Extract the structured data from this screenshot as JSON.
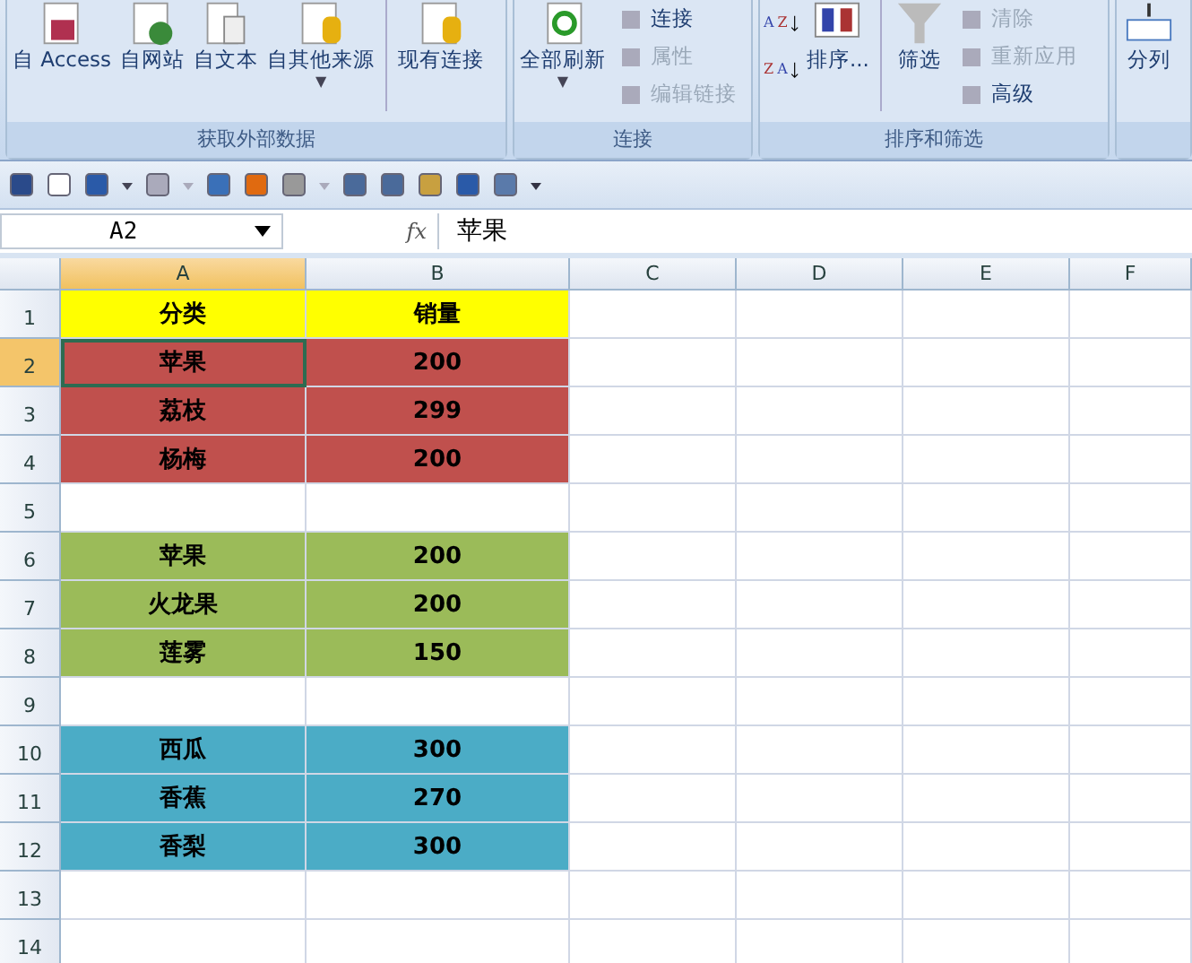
{
  "ribbon": {
    "groups": [
      {
        "label": "获取外部数据",
        "items": [
          {
            "kind": "large",
            "label": "自 Access"
          },
          {
            "kind": "large",
            "label": "自网站"
          },
          {
            "kind": "large",
            "label": "自文本"
          },
          {
            "kind": "large",
            "label": "自其他来源",
            "caret": "▼"
          },
          {
            "kind": "separator"
          },
          {
            "kind": "large",
            "label": "现有连接"
          }
        ]
      },
      {
        "label": "连接",
        "items": [
          {
            "kind": "large",
            "label": "全部刷新",
            "caret": "▼"
          },
          {
            "kind": "stack",
            "entries": [
              {
                "label": "连接",
                "disabled": false
              },
              {
                "label": "属性",
                "disabled": true
              },
              {
                "label": "编辑链接",
                "disabled": true
              }
            ]
          }
        ]
      },
      {
        "label": "排序和筛选",
        "items": [
          {
            "kind": "sortpair",
            "buttons": [
              {
                "top": "A",
                "bottom": "Z"
              },
              {
                "top": "Z",
                "bottom": "A"
              }
            ]
          },
          {
            "kind": "large",
            "label": "排序..."
          },
          {
            "kind": "separator"
          },
          {
            "kind": "large",
            "label": "筛选"
          },
          {
            "kind": "stack",
            "entries": [
              {
                "label": "清除",
                "disabled": true
              },
              {
                "label": "重新应用",
                "disabled": true
              },
              {
                "label": "高级",
                "disabled": false
              }
            ]
          }
        ]
      },
      {
        "items": [
          {
            "kind": "large",
            "label": "分列"
          }
        ]
      }
    ]
  },
  "formula_bar": {
    "name_box": "A2",
    "function_label": "fx",
    "formula": "苹果"
  },
  "sheet": {
    "columns": [
      {
        "label": "A",
        "selected": true
      },
      {
        "label": "B",
        "selected": false
      },
      {
        "label": "C",
        "selected": false
      },
      {
        "label": "D",
        "selected": false
      },
      {
        "label": "E",
        "selected": false
      },
      {
        "label": "F",
        "selected": false
      }
    ],
    "rows": [
      {
        "label": "1",
        "selected": false,
        "color": "#ffff00",
        "cells": [
          {
            "text": "分类",
            "selected": false
          },
          {
            "text": "销量",
            "selected": false
          }
        ]
      },
      {
        "label": "2",
        "selected": true,
        "color": "#c0504d",
        "cells": [
          {
            "text": "苹果",
            "selected": true
          },
          {
            "text": "200",
            "selected": false
          }
        ]
      },
      {
        "label": "3",
        "selected": false,
        "color": "#c0504d",
        "cells": [
          {
            "text": "荔枝",
            "selected": false
          },
          {
            "text": "299",
            "selected": false
          }
        ]
      },
      {
        "label": "4",
        "selected": false,
        "color": "#c0504d",
        "cells": [
          {
            "text": "杨梅",
            "selected": false
          },
          {
            "text": "200",
            "selected": false
          }
        ]
      },
      {
        "label": "5",
        "selected": false,
        "cells": []
      },
      {
        "label": "6",
        "selected": false,
        "color": "#9bbb59",
        "cells": [
          {
            "text": "苹果",
            "selected": false
          },
          {
            "text": "200",
            "selected": false
          }
        ]
      },
      {
        "label": "7",
        "selected": false,
        "color": "#9bbb59",
        "cells": [
          {
            "text": "火龙果",
            "selected": false
          },
          {
            "text": "200",
            "selected": false
          }
        ]
      },
      {
        "label": "8",
        "selected": false,
        "color": "#9bbb59",
        "cells": [
          {
            "text": "莲雾",
            "selected": false
          },
          {
            "text": "150",
            "selected": false
          }
        ]
      },
      {
        "label": "9",
        "selected": false,
        "cells": []
      },
      {
        "label": "10",
        "selected": false,
        "color": "#4bacc6",
        "cells": [
          {
            "text": "西瓜",
            "selected": false
          },
          {
            "text": "300",
            "selected": false
          }
        ]
      },
      {
        "label": "11",
        "selected": false,
        "color": "#4bacc6",
        "cells": [
          {
            "text": "香蕉",
            "selected": false
          },
          {
            "text": "270",
            "selected": false
          }
        ]
      },
      {
        "label": "12",
        "selected": false,
        "color": "#4bacc6",
        "cells": [
          {
            "text": "香梨",
            "selected": false
          },
          {
            "text": "300",
            "selected": false
          }
        ]
      },
      {
        "label": "13",
        "selected": false,
        "cells": []
      },
      {
        "label": "14",
        "selected": false,
        "cells": []
      }
    ]
  }
}
